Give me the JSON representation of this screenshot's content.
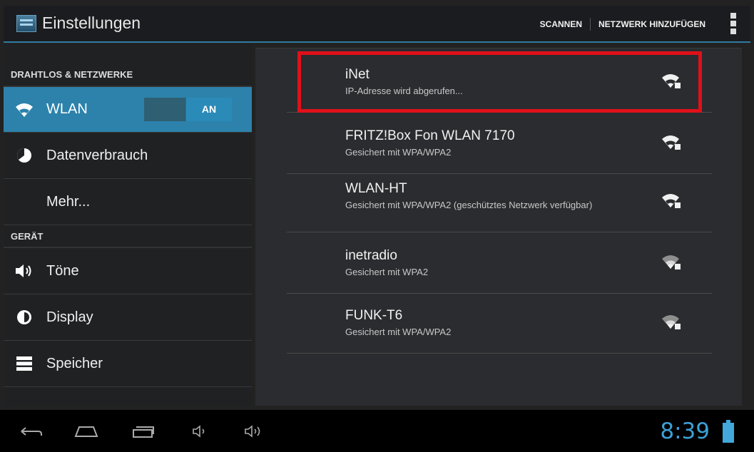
{
  "header": {
    "title": "Einstellungen",
    "actions": [
      "SCANNEN",
      "NETZWERK HINZUFÜGEN"
    ]
  },
  "sidebar": {
    "sections": [
      {
        "label": "DRAHTLOS & NETZWERKE"
      },
      {
        "label": "GERÄT"
      }
    ],
    "items": [
      {
        "label": "WLAN",
        "toggle": "AN"
      },
      {
        "label": "Datenverbrauch"
      },
      {
        "label": "Mehr..."
      },
      {
        "label": "Töne"
      },
      {
        "label": "Display"
      },
      {
        "label": "Speicher"
      }
    ]
  },
  "networks": [
    {
      "name": "iNet",
      "status": "IP-Adresse wird abgerufen...",
      "signal": "strong"
    },
    {
      "name": "FRITZ!Box Fon WLAN 7170",
      "status": "Gesichert mit WPA/WPA2",
      "signal": "strong"
    },
    {
      "name": "WLAN-HT",
      "status": "Gesichert mit WPA/WPA2 (geschütztes Netzwerk verfügbar)",
      "signal": "strong"
    },
    {
      "name": "inetradio",
      "status": "Gesichert mit WPA2",
      "signal": "medium"
    },
    {
      "name": "FUNK-T6",
      "status": "Gesichert mit WPA/WPA2",
      "signal": "medium"
    }
  ],
  "status": {
    "time": "8:39"
  },
  "colors": {
    "accent": "#2c82ab",
    "highlight": "#e0101a",
    "clock": "#3ea0d5"
  }
}
